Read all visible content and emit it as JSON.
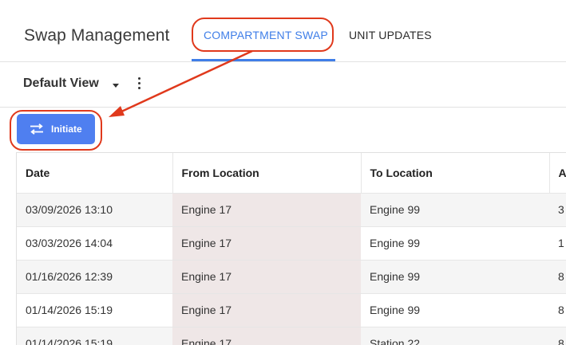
{
  "header": {
    "title": "Swap Management",
    "tabs": [
      {
        "label": "COMPARTMENT SWAP",
        "active": true
      },
      {
        "label": "UNIT UPDATES",
        "active": false
      }
    ]
  },
  "view": {
    "label": "Default View",
    "caret_icon": "caret-down-icon",
    "more_icon": "kebab-menu-icon"
  },
  "actions": {
    "initiate_label": "Initiate",
    "initiate_icon": "swap-arrows-icon"
  },
  "table": {
    "columns": [
      "Date",
      "From Location",
      "To Location",
      "As"
    ],
    "rows": [
      {
        "date": "03/09/2026 13:10",
        "from": "Engine 17",
        "to": "Engine 99",
        "extra": "3"
      },
      {
        "date": "03/03/2026 14:04",
        "from": "Engine 17",
        "to": "Engine 99",
        "extra": "1"
      },
      {
        "date": "01/16/2026 12:39",
        "from": "Engine 17",
        "to": "Engine 99",
        "extra": "8"
      },
      {
        "date": "01/14/2026 15:19",
        "from": "Engine 17",
        "to": "Engine 99",
        "extra": "8"
      },
      {
        "date": "01/14/2026 15:19",
        "from": "Engine 17",
        "to": "Station 22",
        "extra": "8"
      }
    ]
  },
  "colors": {
    "accent": "#3f7ee8",
    "button": "#4f7ff0",
    "annotation": "#e0391c"
  }
}
